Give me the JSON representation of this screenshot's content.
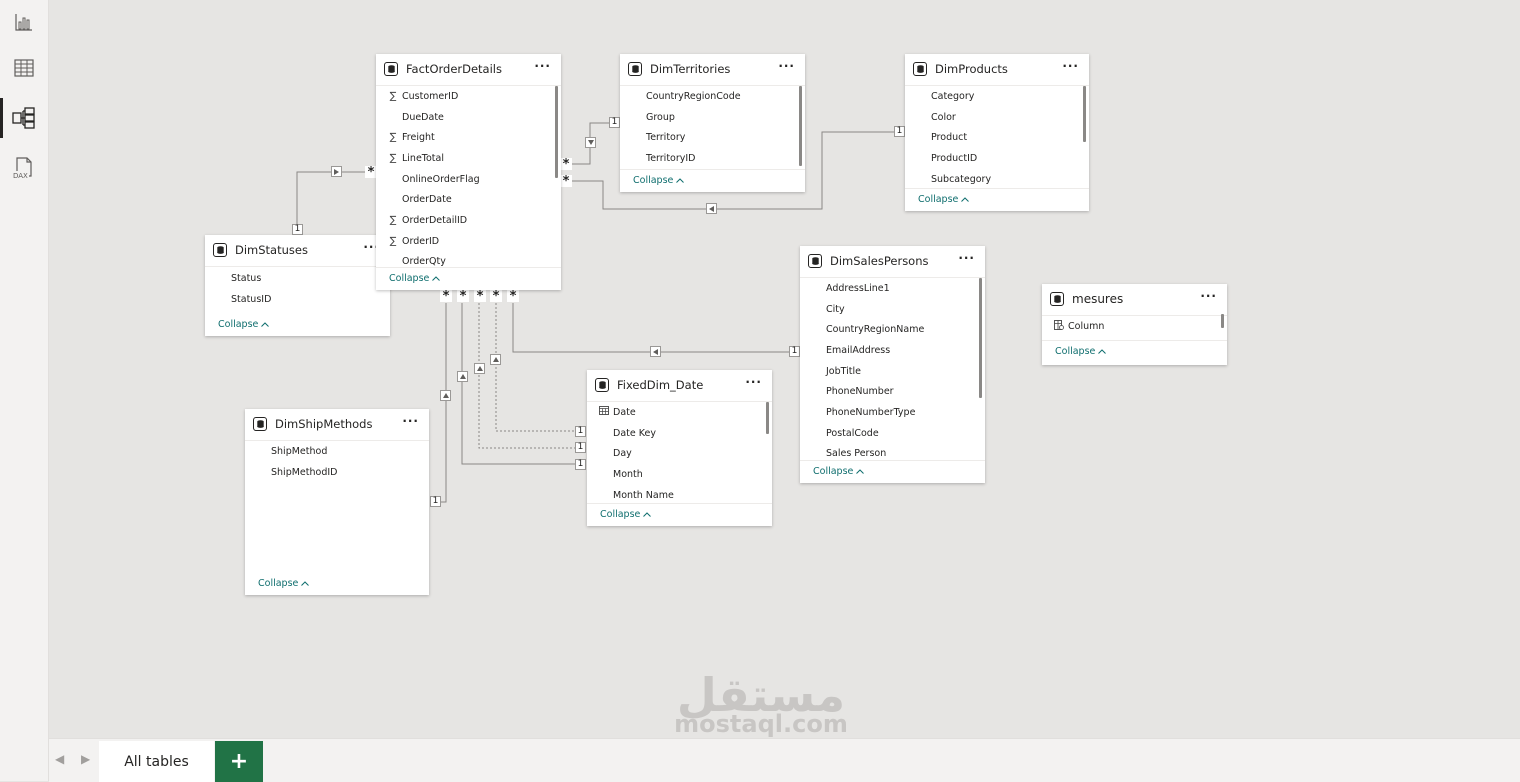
{
  "rail": {
    "items": [
      {
        "name": "report-view",
        "icon": "bar-chart-icon"
      },
      {
        "name": "table-view",
        "icon": "table-grid-icon"
      },
      {
        "name": "model-view",
        "icon": "model-diagram-icon",
        "active": true
      },
      {
        "name": "dax-query-view",
        "icon": "dax-icon",
        "label": "DAX"
      }
    ]
  },
  "tables": {
    "fact_order_details": {
      "title": "FactOrderDetails",
      "more": "···",
      "fields": [
        {
          "icon": "sigma-icon",
          "name": "CustomerID"
        },
        {
          "icon": "",
          "name": "DueDate"
        },
        {
          "icon": "sigma-icon",
          "name": "Freight"
        },
        {
          "icon": "sigma-icon",
          "name": "LineTotal"
        },
        {
          "icon": "",
          "name": "OnlineOrderFlag"
        },
        {
          "icon": "",
          "name": "OrderDate"
        },
        {
          "icon": "sigma-icon",
          "name": "OrderDetailID"
        },
        {
          "icon": "sigma-icon",
          "name": "OrderID"
        },
        {
          "icon": "",
          "name": "OrderQty"
        }
      ],
      "collapse": "Collapse"
    },
    "dim_territories": {
      "title": "DimTerritories",
      "more": "···",
      "fields": [
        {
          "icon": "",
          "name": "CountryRegionCode"
        },
        {
          "icon": "",
          "name": "Group"
        },
        {
          "icon": "",
          "name": "Territory"
        },
        {
          "icon": "",
          "name": "TerritoryID"
        }
      ],
      "collapse": "Collapse"
    },
    "dim_products": {
      "title": "DimProducts",
      "more": "···",
      "fields": [
        {
          "icon": "",
          "name": "Category"
        },
        {
          "icon": "",
          "name": "Color"
        },
        {
          "icon": "",
          "name": "Product"
        },
        {
          "icon": "",
          "name": "ProductID"
        },
        {
          "icon": "",
          "name": "Subcategory"
        }
      ],
      "collapse": "Collapse"
    },
    "dim_statuses": {
      "title": "DimStatuses",
      "more": "···",
      "fields": [
        {
          "icon": "",
          "name": "Status"
        },
        {
          "icon": "",
          "name": "StatusID"
        }
      ],
      "collapse": "Collapse"
    },
    "dim_sales_persons": {
      "title": "DimSalesPersons",
      "more": "···",
      "fields": [
        {
          "icon": "",
          "name": "AddressLine1"
        },
        {
          "icon": "",
          "name": "City"
        },
        {
          "icon": "",
          "name": "CountryRegionName"
        },
        {
          "icon": "",
          "name": "EmailAddress"
        },
        {
          "icon": "",
          "name": "JobTitle"
        },
        {
          "icon": "",
          "name": "PhoneNumber"
        },
        {
          "icon": "",
          "name": "PhoneNumberType"
        },
        {
          "icon": "",
          "name": "PostalCode"
        },
        {
          "icon": "",
          "name": "Sales Person"
        }
      ],
      "collapse": "Collapse"
    },
    "mesures": {
      "title": "mesures",
      "more": "···",
      "fields": [
        {
          "icon": "calc-column-icon",
          "name": "Column"
        }
      ],
      "collapse": "Collapse"
    },
    "fixed_dim_date": {
      "title": "FixedDim_Date",
      "more": "···",
      "fields": [
        {
          "icon": "calendar-icon",
          "name": "Date"
        },
        {
          "icon": "",
          "name": "Date Key"
        },
        {
          "icon": "",
          "name": "Day"
        },
        {
          "icon": "",
          "name": "Month"
        },
        {
          "icon": "",
          "name": "Month Name"
        }
      ],
      "collapse": "Collapse"
    },
    "dim_ship_methods": {
      "title": "DimShipMethods",
      "more": "···",
      "fields": [
        {
          "icon": "",
          "name": "ShipMethod"
        },
        {
          "icon": "",
          "name": "ShipMethodID"
        }
      ],
      "collapse": "Collapse"
    }
  },
  "cardinality": {
    "one": "1",
    "many": "*"
  },
  "bottom": {
    "prev": "◀",
    "next": "▶",
    "tab_label": "All tables",
    "add_label": "+"
  },
  "watermark": {
    "arabic": "مستقل",
    "latin": "mostaql.com"
  }
}
